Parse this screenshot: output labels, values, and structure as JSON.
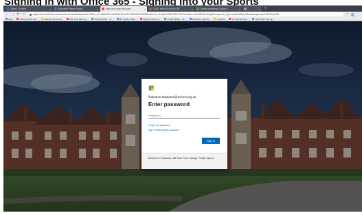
{
  "page": {
    "title": "Signing in with Office 365 - Signing into your Sports"
  },
  "browser": {
    "tabs": [
      {
        "label": "Inbox - Oracle",
        "favicon_color": "#1a73e8",
        "active": false
      },
      {
        "label": "Microsoft Teams Work...",
        "favicon_color": "#5b5fc7",
        "active": false
      },
      {
        "label": "Sign in to your account",
        "favicon_color": "#f25022",
        "active": true
      },
      {
        "label": "OOS: Why 50 choice Off",
        "favicon_color": "#e8453c",
        "active": false
      },
      {
        "label": "Sports Academy Online F...",
        "favicon_color": "#34a853",
        "active": false
      },
      {
        "label": "",
        "favicon_color": "#9aa0a6",
        "active": false
      }
    ],
    "new_tab_glyph": "+",
    "nav": {
      "back_glyph": "←",
      "forward_glyph": "→",
      "reload_glyph": "⟳",
      "home_glyph": "⌂"
    },
    "url": "login.microsoftonline.com/common/oauth2/authorize?client_id=4345a7b9-9a63-4910-a426-35363201d503&redirect_uri=https%3A%2F%2Fwww.office.com%2Flandingv2&response_type=code%20id_token&scope=openid%20profile",
    "bookmarks": [
      {
        "label": "Apps",
        "color": "#4285f4"
      },
      {
        "label": "Training Admin Da...",
        "color": "#ea4335"
      },
      {
        "label": "Student TAS Admin...",
        "color": "#fbbc05"
      },
      {
        "label": "SCI Tools Beta Ho...",
        "color": "#ea4335"
      },
      {
        "label": "Content Editor - Ta...",
        "color": "#34a853"
      },
      {
        "label": "MK Leader Dash...",
        "color": "#4285f4"
      },
      {
        "label": "Planner Admin Pa...",
        "color": "#ea4335"
      },
      {
        "label": "Content Editor - Ta...",
        "color": "#34a853"
      },
      {
        "label": "Wellbeing Hub Pa...",
        "color": "#4285f4"
      },
      {
        "label": "Locations",
        "color": "#fbbc05"
      },
      {
        "label": "GS Shared Drive...",
        "color": "#ea4335"
      },
      {
        "label": "O365 Staff Tips Sa...",
        "color": "#4285f4"
      }
    ]
  },
  "signin": {
    "email": "firstname.lastname@school.org.uk",
    "heading": "Enter password",
    "password_placeholder": "Password",
    "forgot_link": "Forgot my password",
    "alt_link": "Sign in with another account",
    "button_label": "Sign in",
    "footer_text": "Welcome to Redwood Hall Sixth Form College. Please Sign In",
    "logo_colors": [
      "#f25022",
      "#7fba00",
      "#00a4ef",
      "#ffb900"
    ]
  }
}
